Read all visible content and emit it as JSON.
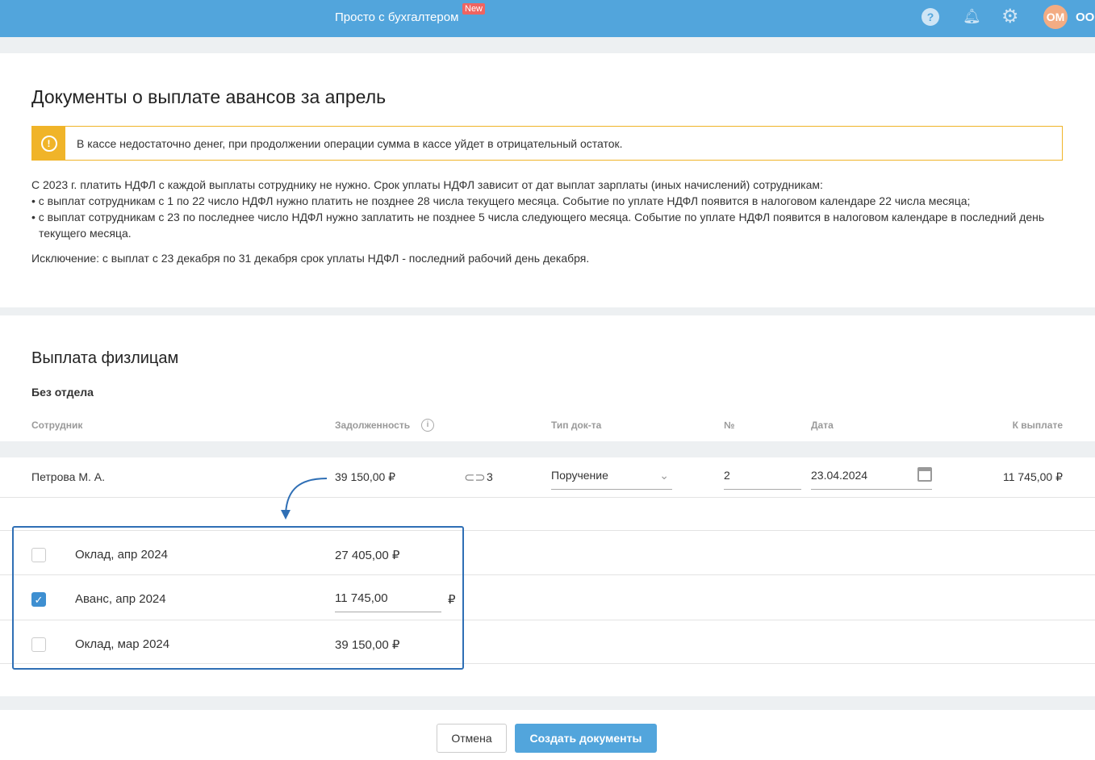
{
  "header": {
    "brand": "Просто с бухгалтером",
    "new_badge": "New",
    "avatar": "ОМ",
    "org": "ООО"
  },
  "title": "Документы о выплате авансов за апрель",
  "warning": "В кассе недостаточно денег, при продолжении операции сумма в кассе уйдет в отрицательный остаток.",
  "info": {
    "p1": "С 2023 г. платить НДФЛ с каждой выплаты сотруднику не нужно. Срок уплаты НДФЛ зависит от дат выплат зарплаты (иных начислений) сотрудникам:",
    "b1": "• с выплат сотрудникам с 1 по 22 число НДФЛ нужно платить не позднее 28 числа текущего месяца. Событие по уплате НДФЛ появится в налоговом календаре 22 числа месяца;",
    "b2": "• с выплат сотрудникам с 23 по последнее число НДФЛ нужно заплатить не позднее 5 числа следующего месяца. Событие по уплате НДФЛ появится в налоговом календаре в последний день текущего месяца.",
    "p2": "Исключение: с выплат с 23 декабря по 31 декабря срок уплаты НДФЛ - последний рабочий день декабря."
  },
  "section": {
    "title": "Выплата физлицам",
    "group": "Без отдела"
  },
  "columns": {
    "employee": "Сотрудник",
    "debt": "Задолженность",
    "doctype": "Тип док-та",
    "num": "№",
    "date": "Дата",
    "pay": "К выплате"
  },
  "row": {
    "employee": "Петрова М. А.",
    "debt": "39 150,00 ₽",
    "links": "3",
    "doctype": "Поручение",
    "num": "2",
    "date": "23.04.2024",
    "pay": "11 745,00 ₽"
  },
  "items": [
    {
      "label": "Оклад, апр 2024",
      "amount": "27 405,00 ₽"
    },
    {
      "label": "Аванс, апр 2024",
      "amount": "11 745,00",
      "currency": "₽"
    },
    {
      "label": "Оклад, мар 2024",
      "amount": "39 150,00 ₽"
    }
  ],
  "buttons": {
    "cancel": "Отмена",
    "create": "Создать документы"
  }
}
